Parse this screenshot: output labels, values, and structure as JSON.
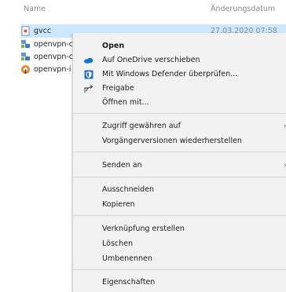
{
  "header": {
    "name_label": "Name",
    "date_label": "Änderungsdatum"
  },
  "files": [
    {
      "name": "gvcc",
      "date": "27.03.2020 07:58",
      "icon": "document-icon"
    },
    {
      "name": "openvpn-c",
      "date": "",
      "icon": "network-config-icon"
    },
    {
      "name": "openvpn-c",
      "date": "",
      "icon": "network-config-icon"
    },
    {
      "name": "openvpn-i",
      "date": "",
      "icon": "openvpn-installer-icon"
    }
  ],
  "menu": {
    "open": "Open",
    "onedrive": "Auf OneDrive verschieben",
    "defender": "Mit Windows Defender überprüfen...",
    "share": "Freigabe",
    "open_with": "Öffnen mit...",
    "grant_access": "Zugriff gewähren auf",
    "restore_versions": "Vorgängerversionen wiederherstellen",
    "send_to": "Senden an",
    "cut": "Ausschneiden",
    "copy": "Kopieren",
    "create_shortcut": "Verknüpfung erstellen",
    "delete": "Löschen",
    "rename": "Umbenennen",
    "properties": "Eigenschaften",
    "submenu_arrow": "›"
  },
  "colors": {
    "selection": "#cce8ff",
    "menu_bg": "#f2f2f2",
    "onedrive": "#1a73c8",
    "defender": "#1f6fbf"
  }
}
